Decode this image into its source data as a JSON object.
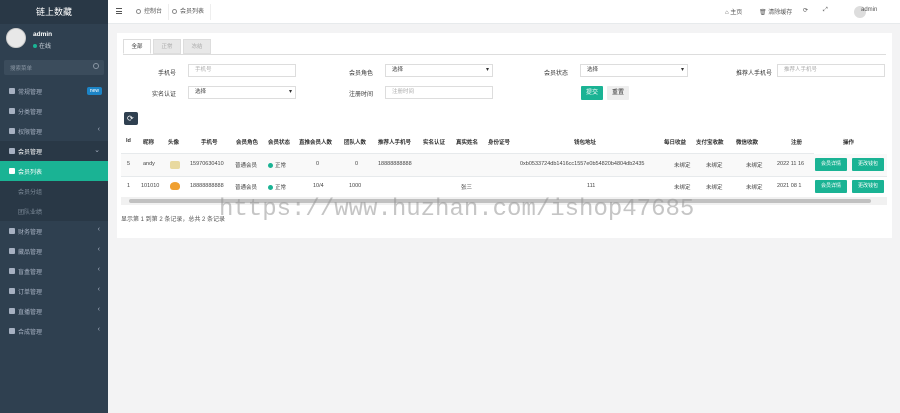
{
  "sidebar": {
    "brand": "链上数藏",
    "user": {
      "name": "admin",
      "status": "在线"
    },
    "search_placeholder": "搜索菜单",
    "items": [
      {
        "label": "常规管理",
        "badge": "new"
      },
      {
        "label": "分类管理"
      },
      {
        "label": "权限管理"
      },
      {
        "label": "会员管理"
      },
      {
        "label": "会员列表"
      },
      {
        "label": "会员分组"
      },
      {
        "label": "团队业绩"
      },
      {
        "label": "财务管理"
      },
      {
        "label": "藏品管理"
      },
      {
        "label": "盲盒管理"
      },
      {
        "label": "订单管理"
      },
      {
        "label": "直播管理"
      },
      {
        "label": "合成管理"
      }
    ]
  },
  "topbar": {
    "tabs": [
      "控制台",
      "会员列表"
    ],
    "home": "主页",
    "clear_cache": "清除缓存",
    "user": "admin"
  },
  "filter_tabs": [
    "全部",
    "正常",
    "冻结"
  ],
  "filters": {
    "phone": {
      "label": "手机号",
      "placeholder": "手机号"
    },
    "role": {
      "label": "会员角色",
      "value": "选择"
    },
    "status": {
      "label": "会员状态",
      "value": "选择"
    },
    "inviter_phone": {
      "label": "推荐人手机号",
      "placeholder": "推荐人手机号"
    },
    "realname": {
      "label": "实名认证",
      "value": "选择"
    },
    "regtime": {
      "label": "注册时间",
      "placeholder": "注册时间"
    },
    "submit": "提交",
    "reset": "重置"
  },
  "table": {
    "headers": [
      "Id",
      "昵称",
      "头像",
      "手机号",
      "会员角色",
      "会员状态",
      "直推会员人数",
      "团队人数",
      "推荐人手机号",
      "实名认证",
      "真实姓名",
      "身份证号",
      "钱包地址",
      "每日收益",
      "支付宝收款",
      "微信收款",
      "注册",
      "操作"
    ],
    "rows": [
      {
        "id": "5",
        "nickname": "andy",
        "phone": "15970630410",
        "role": "普通会员",
        "status": "正常",
        "direct": "0",
        "team": "0",
        "inviter": "18888888888",
        "realname": "",
        "truename": "",
        "idcard": "",
        "wallet": "0xb0533724db1416cc1557e0b54820b4804db2435",
        "daily": "未绑定",
        "alipay": "未绑定",
        "wechat": "未绑定",
        "reg": "2022 11 16",
        "ops": [
          "会员详情",
          "更改钱包"
        ]
      },
      {
        "id": "1",
        "nickname": "101010",
        "phone": "18888888888",
        "role": "普通会员",
        "status": "正常",
        "direct": "10/4",
        "team": "1000",
        "inviter": "",
        "realname": "",
        "truename": "张三",
        "idcard": "",
        "wallet": "111",
        "daily": "未绑定",
        "alipay": "未绑定",
        "wechat": "未绑定",
        "reg": "2021 08 1",
        "ops": [
          "会员详情",
          "更改钱包"
        ]
      }
    ]
  },
  "pager": "显示第 1 到第 2 条记录，总共 2 条记录",
  "watermark": "https://www.huzhan.com/ishop47685",
  "colors": {
    "sidebar": "#2f4050",
    "accent": "#1ab394",
    "badge": "#1c84c6"
  }
}
